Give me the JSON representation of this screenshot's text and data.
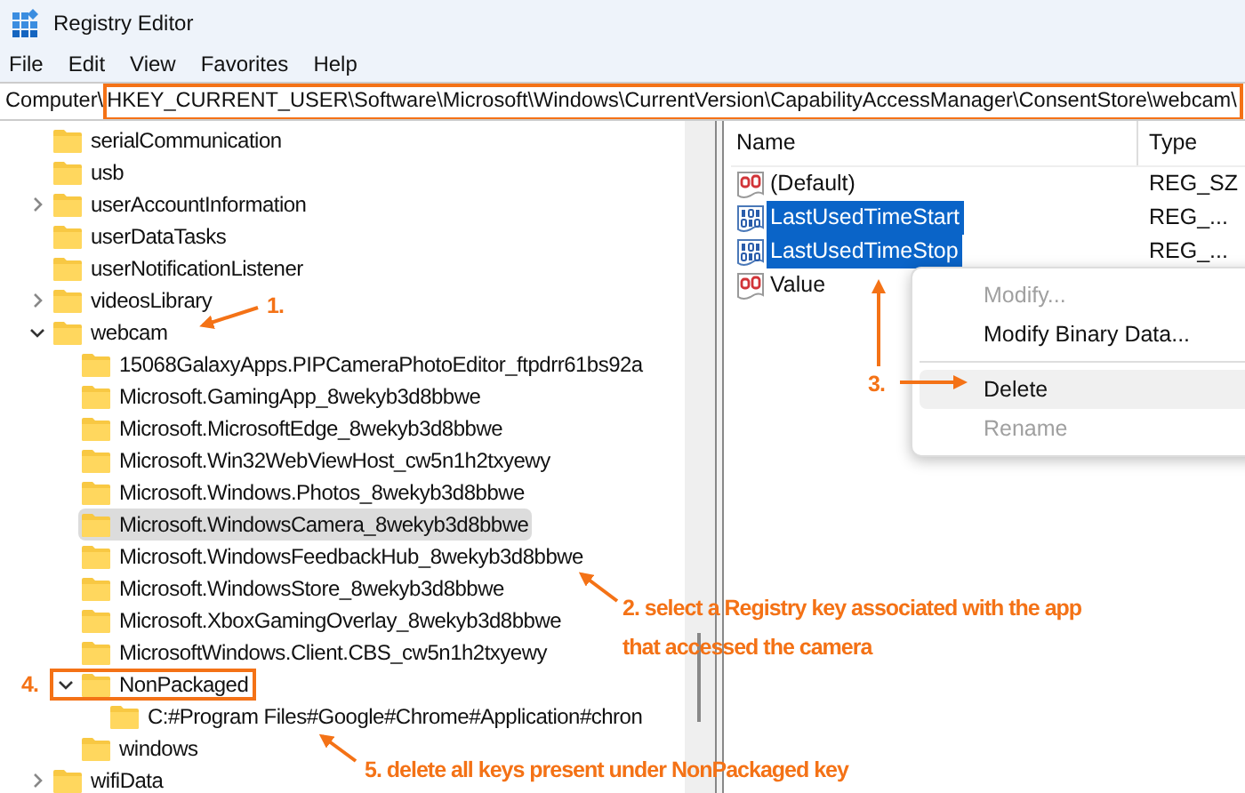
{
  "window": {
    "title": "Registry Editor"
  },
  "menu": [
    "File",
    "Edit",
    "View",
    "Favorites",
    "Help"
  ],
  "address": {
    "prefix": "Computer\\",
    "path": "HKEY_CURRENT_USER\\Software\\Microsoft\\Windows\\CurrentVersion\\CapabilityAccessManager\\ConsentStore\\webcam\\",
    "highlighted": true
  },
  "tree": [
    {
      "label": "serialCommunication"
    },
    {
      "label": "usb"
    },
    {
      "label": "userAccountInformation",
      "expanded": false
    },
    {
      "label": "userDataTasks"
    },
    {
      "label": "userNotificationListener"
    },
    {
      "label": "videosLibrary",
      "expanded": false
    },
    {
      "label": "webcam",
      "expanded": true,
      "children": [
        {
          "label": "15068GalaxyApps.PIPCameraPhotoEditor_ftpdrr61bs92a"
        },
        {
          "label": "Microsoft.GamingApp_8wekyb3d8bbwe"
        },
        {
          "label": "Microsoft.MicrosoftEdge_8wekyb3d8bbwe"
        },
        {
          "label": "Microsoft.Win32WebViewHost_cw5n1h2txyewy"
        },
        {
          "label": "Microsoft.Windows.Photos_8wekyb3d8bbwe"
        },
        {
          "label": "Microsoft.WindowsCamera_8wekyb3d8bbwe",
          "selected": true
        },
        {
          "label": "Microsoft.WindowsFeedbackHub_8wekyb3d8bbwe"
        },
        {
          "label": "Microsoft.WindowsStore_8wekyb3d8bbwe"
        },
        {
          "label": "Microsoft.XboxGamingOverlay_8wekyb3d8bbwe"
        },
        {
          "label": "MicrosoftWindows.Client.CBS_cw5n1h2txyewy"
        },
        {
          "label": "NonPackaged",
          "expanded": true,
          "highlighted": true,
          "children": [
            {
              "label": "C:#Program Files#Google#Chrome#Application#chron"
            }
          ]
        },
        {
          "label": "windows"
        }
      ]
    },
    {
      "label": "wifiData",
      "expanded": false
    }
  ],
  "values": {
    "columns": [
      "Name",
      "Type"
    ],
    "rows": [
      {
        "name": "(Default)",
        "kind": "string",
        "type": "REG_SZ",
        "selected": false
      },
      {
        "name": "LastUsedTimeStart",
        "kind": "binary",
        "type": "REG_...",
        "selected": true
      },
      {
        "name": "LastUsedTimeStop",
        "kind": "binary",
        "type": "REG_...",
        "selected": true
      },
      {
        "name": "Value",
        "kind": "string",
        "selected": false
      }
    ]
  },
  "context_menu": [
    [
      {
        "label": "Modify...",
        "disabled": true,
        "highlighted": false
      },
      {
        "label": "Modify Binary Data...",
        "disabled": false,
        "highlighted": false
      }
    ],
    [
      {
        "label": "Delete",
        "disabled": false,
        "highlighted": true
      },
      {
        "label": "Rename",
        "disabled": true,
        "highlighted": false
      }
    ]
  ],
  "annotations": [
    {
      "lines": [
        "1."
      ]
    },
    {
      "lines": [
        "3."
      ]
    },
    {
      "lines": [
        "2. select a Registry key associated with the app",
        "that accessed the camera"
      ]
    },
    {
      "lines": [
        "4."
      ]
    },
    {
      "lines": [
        "5. delete all keys present under NonPackaged key"
      ]
    }
  ]
}
